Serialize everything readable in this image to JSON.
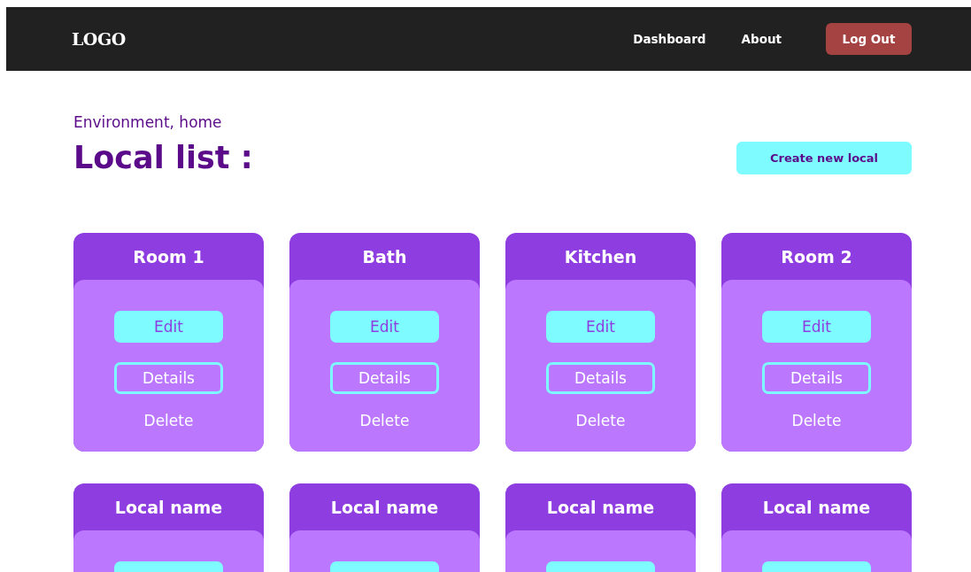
{
  "header": {
    "logo": "LOGO",
    "nav": [
      {
        "label": "Dashboard",
        "kind": "link"
      },
      {
        "label": "About",
        "kind": "link"
      },
      {
        "label": "Log Out",
        "kind": "button"
      }
    ]
  },
  "breadcrumb": "Environment, home",
  "title": "Local list :",
  "create_button": "Create new local",
  "locals": [
    {
      "name": "Room 1",
      "actions": [
        "Edit",
        "Details",
        "Delete"
      ]
    },
    {
      "name": "Bath",
      "actions": [
        "Edit",
        "Details",
        "Delete"
      ]
    },
    {
      "name": "Kitchen",
      "actions": [
        "Edit",
        "Details",
        "Delete"
      ]
    },
    {
      "name": "Room 2",
      "actions": [
        "Edit",
        "Details",
        "Delete"
      ]
    },
    {
      "name": "Local name"
    },
    {
      "name": "Local name"
    },
    {
      "name": "Local name"
    },
    {
      "name": "Local name"
    }
  ]
}
